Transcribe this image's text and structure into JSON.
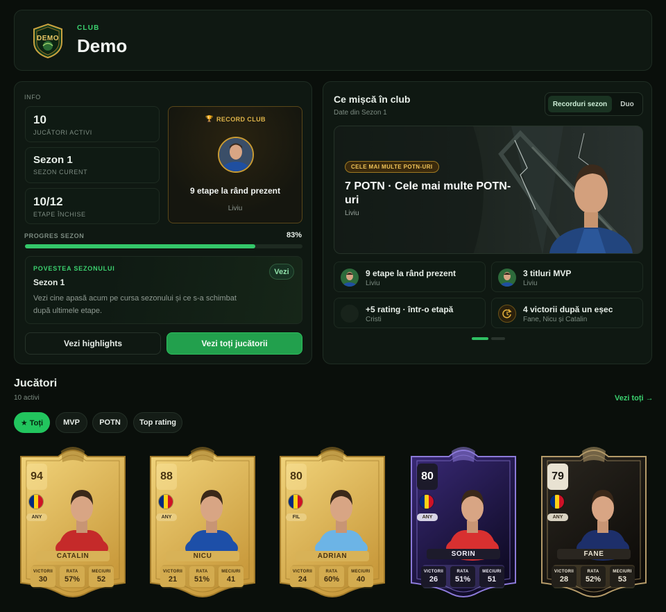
{
  "header": {
    "club_label": "CLUB",
    "club_name": "Demo",
    "logo_text": "DEMO"
  },
  "info": {
    "section_label": "INFO",
    "stats": [
      {
        "value": "10",
        "label": "JUCĂTORI ACTIVI"
      },
      {
        "value": "Sezon 1",
        "label": "SEZON CURENT"
      },
      {
        "value": "10/12",
        "label": "ETAPE ÎNCHISE"
      }
    ],
    "record": {
      "label": "RECORD CLUB",
      "title": "9 etape la rând prezent",
      "player": "Liviu"
    },
    "progress": {
      "label": "PROGRES SEZON",
      "value_text": "83%",
      "value": 0.83
    },
    "story": {
      "label": "POVESTEA SEZONULUI",
      "title": "Sezon 1",
      "text": "Vezi cine apasă acum pe cursa sezonului și ce s-a schimbat după ultimele etape.",
      "button": "Vezi"
    },
    "buttons": {
      "highlights": "Vezi highlights",
      "all_players": "Vezi toți jucătorii"
    }
  },
  "club_activity": {
    "title": "Ce mișcă în club",
    "subtitle": "Date din Sezon 1",
    "tabs": [
      "Recorduri sezon",
      "Duo"
    ],
    "active_tab": 0,
    "banner": {
      "badge": "CELE MAI MULTE POTN-URI",
      "title": "7 POTN · Cele mai multe POTN-uri",
      "player": "Liviu"
    },
    "highlights": [
      {
        "title": "9 etape la rând prezent",
        "sub": "Liviu",
        "icon": "player-avatar"
      },
      {
        "title": "3 titluri MVP",
        "sub": "Liviu",
        "icon": "player-avatar"
      },
      {
        "title": "+5 rating · într-o etapă",
        "sub": "Cristi",
        "icon": "empty-avatar"
      },
      {
        "title": "4 victorii după un eșec",
        "sub": "Fane, Nicu și Catalin",
        "icon": "comeback-icon"
      }
    ],
    "pagination": {
      "pages": 2,
      "current": 0
    }
  },
  "players": {
    "title": "Jucători",
    "count_text": "10 activi",
    "see_all": "Vezi toți →",
    "filters": [
      "★ Toți",
      "MVP",
      "POTN",
      "Top rating"
    ],
    "active_filter": 0,
    "stat_labels": [
      "VICTORII",
      "RATA",
      "MECIURI"
    ],
    "cards": [
      {
        "rating": "94",
        "position": "ANY",
        "name": "CATALIN",
        "wins": "30",
        "rate": "57%",
        "matches": "52",
        "theme": "gold",
        "shirt": "#c52a2a"
      },
      {
        "rating": "88",
        "position": "ANY",
        "name": "NICU",
        "wins": "21",
        "rate": "51%",
        "matches": "41",
        "theme": "gold",
        "shirt": "#1d4fa8"
      },
      {
        "rating": "80",
        "position": "FIL",
        "name": "ADRIAN",
        "wins": "24",
        "rate": "60%",
        "matches": "40",
        "theme": "gold",
        "shirt": "#6cb4e6"
      },
      {
        "rating": "80",
        "position": "ANY",
        "name": "SORIN",
        "wins": "26",
        "rate": "51%",
        "matches": "51",
        "theme": "purple",
        "shirt": "#d83030"
      },
      {
        "rating": "79",
        "position": "ANY",
        "name": "FANE",
        "wins": "28",
        "rate": "52%",
        "matches": "53",
        "theme": "black",
        "shirt": "#1d2f6a"
      }
    ]
  },
  "colors": {
    "accent": "#22c55e",
    "gold": "#d9a93e",
    "background": "#0a0f0b"
  }
}
